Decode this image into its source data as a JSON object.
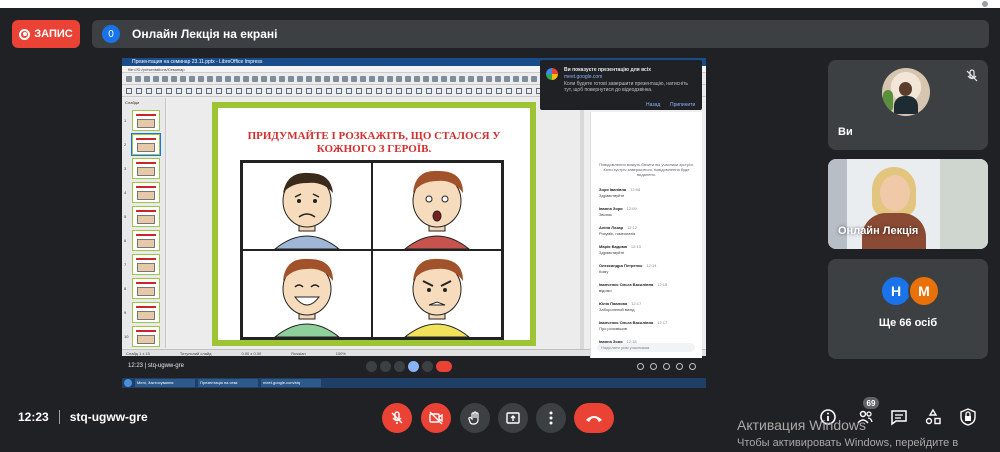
{
  "record": {
    "label": "ЗАПИС"
  },
  "presentation_bar": {
    "count": "0",
    "title": "Онлайн Лекція на екрані"
  },
  "shared_screen": {
    "window_title": "Презентация на семинар 23.11.pptx - LibreOffice Impress",
    "menu_path": "file:///D:/presentations/Семинар",
    "slides_label": "Слайди",
    "thumbnail_numbers": [
      "1",
      "2",
      "3",
      "4",
      "5",
      "6",
      "7",
      "8",
      "9",
      "10",
      "11"
    ],
    "slide_heading": "ПРИДУМАЙТЕ І РОЗКАЖІТЬ, ЩО СТАЛОСЯ У КОЖНОГО З ГЕРОЇВ.",
    "status": [
      "Слайд 1 з 15",
      "Титульний слайд",
      "0.00 x 0.00",
      "Russian",
      "100%"
    ],
    "inner_meeting": {
      "time": "12:23",
      "code": "stq-ugww-gre"
    },
    "taskbar": [
      "Мелі, Застосування",
      "Презентація на семі",
      "meet.google.com/stq"
    ],
    "notification": {
      "title": "Ви показуєте презентацію для всіх",
      "link": "meet.google.com",
      "body": "Коли будете готові завершити презентацію, натисніть тут, щоб повернутися до відеодзвінка.",
      "action_1": "Назад",
      "action_2": "Припинити"
    },
    "chat": {
      "system_text": "Повідомлення можуть бачити всі учасники зустрічі. Коли зустріч завершиться, повідомлення буде видалено.",
      "messages": [
        {
          "author": "Зоря Іванівна",
          "time": "12:08",
          "text": "Здравствуйте"
        },
        {
          "author": "Іванна Зоря",
          "time": "12:09",
          "text": "Звонок"
        },
        {
          "author": "Аліна Лазар",
          "time": "12:12",
          "text": "Розуміє, гомеопатія"
        },
        {
          "author": "Марія Вадима",
          "time": "12:13",
          "text": "Здравствуйте"
        },
        {
          "author": "Олександра Петренко",
          "time": "12:14",
          "text": "Кому"
        },
        {
          "author": "Іванченко Ольга Василівна",
          "time": "12:15",
          "text": "відомо"
        },
        {
          "author": "Юлія Павлова",
          "time": "12:17",
          "text": "Заборонений вихід"
        },
        {
          "author": "Іванченко Ольга Василівна",
          "time": "12:17",
          "text": "Про розсмішив"
        },
        {
          "author": "Іванна Зоря",
          "time": "12:18",
          "text": "Реклама вчать"
        }
      ],
      "input_placeholder": "Надіслати усім учасникам"
    }
  },
  "participants": {
    "self_tile_name": "Ви",
    "presenter_tile_name": "Онлайн Лекція",
    "others_avatars": [
      "Н",
      "М"
    ],
    "others_label": "Ще 66 осіб"
  },
  "bottom_bar": {
    "time": "12:23",
    "meeting_code": "stq-ugww-gre",
    "people_count": "69"
  },
  "overlay": {
    "activation_title": "Активация Windows",
    "activation_text": "Чтобы активировать Windows, перейдите в"
  },
  "colors": {
    "background": "#202124",
    "accent_red": "#ea4335",
    "control_gray": "#3c4043",
    "slide_border": "#9dc435",
    "slide_heading": "#d32f2f"
  },
  "icons": [
    "record-icon",
    "mic-off-icon",
    "camera-off-icon",
    "hand-icon",
    "present-icon",
    "more-icon",
    "hang-up-icon",
    "info-icon",
    "people-icon",
    "chat-icon",
    "activities-icon",
    "lock-icon"
  ]
}
